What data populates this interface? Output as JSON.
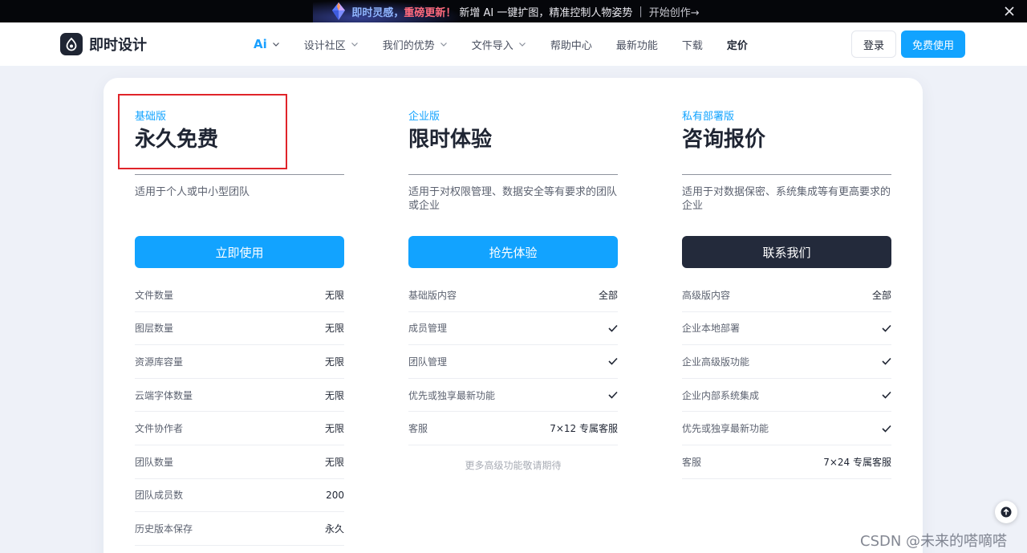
{
  "banner": {
    "highlight1": "即时灵感，",
    "highlight2": "重磅更新！",
    "message": "新增 AI 一键扩图，精准控制人物姿势",
    "separator": "|",
    "cta": "开始创作→",
    "colors": {
      "highlight1": "#8fb5ff",
      "highlight2": "#ff6a7d"
    }
  },
  "header": {
    "logo_text": "即时设计",
    "menu": [
      {
        "label": "Ai",
        "has_dropdown": true
      },
      {
        "label": "设计社区",
        "has_dropdown": true
      },
      {
        "label": "我们的优势",
        "has_dropdown": true
      },
      {
        "label": "文件导入",
        "has_dropdown": true
      },
      {
        "label": "帮助中心",
        "has_dropdown": false
      },
      {
        "label": "最新功能",
        "has_dropdown": false
      },
      {
        "label": "下载",
        "has_dropdown": false
      },
      {
        "label": "定价",
        "has_dropdown": false,
        "active": true
      }
    ],
    "login_label": "登录",
    "free_label": "免费使用"
  },
  "plans": [
    {
      "tier": "基础版",
      "price": "永久免费",
      "description": "适用于个人或中小型团队",
      "cta": "立即使用",
      "features": [
        {
          "name": "文件数量",
          "value": "无限"
        },
        {
          "name": "图层数量",
          "value": "无限"
        },
        {
          "name": "资源库容量",
          "value": "无限"
        },
        {
          "name": "云端字体数量",
          "value": "无限"
        },
        {
          "name": "文件协作者",
          "value": "无限"
        },
        {
          "name": "团队数量",
          "value": "无限"
        },
        {
          "name": "团队成员数",
          "value": "200"
        },
        {
          "name": "历史版本保存",
          "value": "永久"
        }
      ]
    },
    {
      "tier": "企业版",
      "price": "限时体验",
      "description": "适用于对权限管理、数据安全等有要求的团队或企业",
      "cta": "抢先体验",
      "features": [
        {
          "name": "基础版内容",
          "value": "全部"
        },
        {
          "name": "成员管理",
          "value": "check"
        },
        {
          "name": "团队管理",
          "value": "check"
        },
        {
          "name": "优先或独享最新功能",
          "value": "check"
        },
        {
          "name": "客服",
          "value": "7×12 专属客服"
        }
      ],
      "note": "更多高级功能敬请期待"
    },
    {
      "tier": "私有部署版",
      "price": "咨询报价",
      "description": "适用于对数据保密、系统集成等有更高要求的企业",
      "cta": "联系我们",
      "features": [
        {
          "name": "高级版内容",
          "value": "全部"
        },
        {
          "name": "企业本地部署",
          "value": "check"
        },
        {
          "name": "企业高级版功能",
          "value": "check"
        },
        {
          "name": "企业内部系统集成",
          "value": "check"
        },
        {
          "name": "优先或独享最新功能",
          "value": "check"
        },
        {
          "name": "客服",
          "value": "7×24 专属客服"
        }
      ]
    }
  ],
  "watermark": "CSDN @未来的嗒嘀嗒",
  "colors": {
    "accent": "#12a3ff",
    "dark_button": "#232a3b",
    "annotation": "#e0242a"
  }
}
